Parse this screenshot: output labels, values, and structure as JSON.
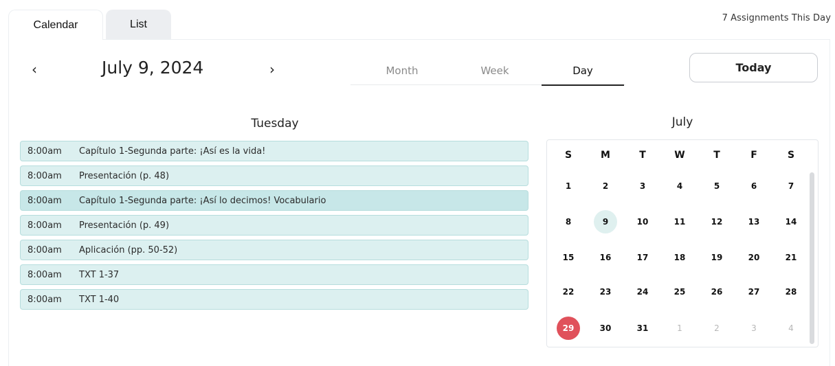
{
  "tabs": {
    "calendar": "Calendar",
    "list": "List"
  },
  "assignment_count": "7 Assignments This Day",
  "nav": {
    "prev": "‹",
    "next": "›",
    "date_title": "July 9, 2024"
  },
  "views": {
    "month": "Month",
    "week": "Week",
    "day": "Day",
    "active": "Day"
  },
  "today_button": "Today",
  "day_heading": "Tuesday",
  "events": [
    {
      "time": "8:00am",
      "title": "Capítulo 1-Segunda parte: ¡Así es la vida!"
    },
    {
      "time": "8:00am",
      "title": "Presentación (p. 48)"
    },
    {
      "time": "8:00am",
      "title": "Capítulo 1-Segunda parte: ¡Así lo decimos! Vocabulario"
    },
    {
      "time": "8:00am",
      "title": "Presentación (p. 49)"
    },
    {
      "time": "8:00am",
      "title": "Aplicación (pp. 50-52)"
    },
    {
      "time": "8:00am",
      "title": "TXT 1-37"
    },
    {
      "time": "8:00am",
      "title": "TXT 1-40"
    }
  ],
  "mini_calendar": {
    "month": "July",
    "weekdays": [
      "S",
      "M",
      "T",
      "W",
      "T",
      "F",
      "S"
    ],
    "weeks": [
      [
        "1",
        "2",
        "3",
        "4",
        "5",
        "6",
        "7"
      ],
      [
        "8",
        "9",
        "10",
        "11",
        "12",
        "13",
        "14"
      ],
      [
        "15",
        "16",
        "17",
        "18",
        "19",
        "20",
        "21"
      ],
      [
        "22",
        "23",
        "24",
        "25",
        "26",
        "27",
        "28"
      ],
      [
        "29",
        "30",
        "31",
        "1",
        "2",
        "3",
        "4"
      ]
    ],
    "selected_day": "9",
    "highlighted_day": "29",
    "accent_color": "#e0515b",
    "selected_color": "#dff0ef",
    "event_color": "#dcf0f0"
  }
}
